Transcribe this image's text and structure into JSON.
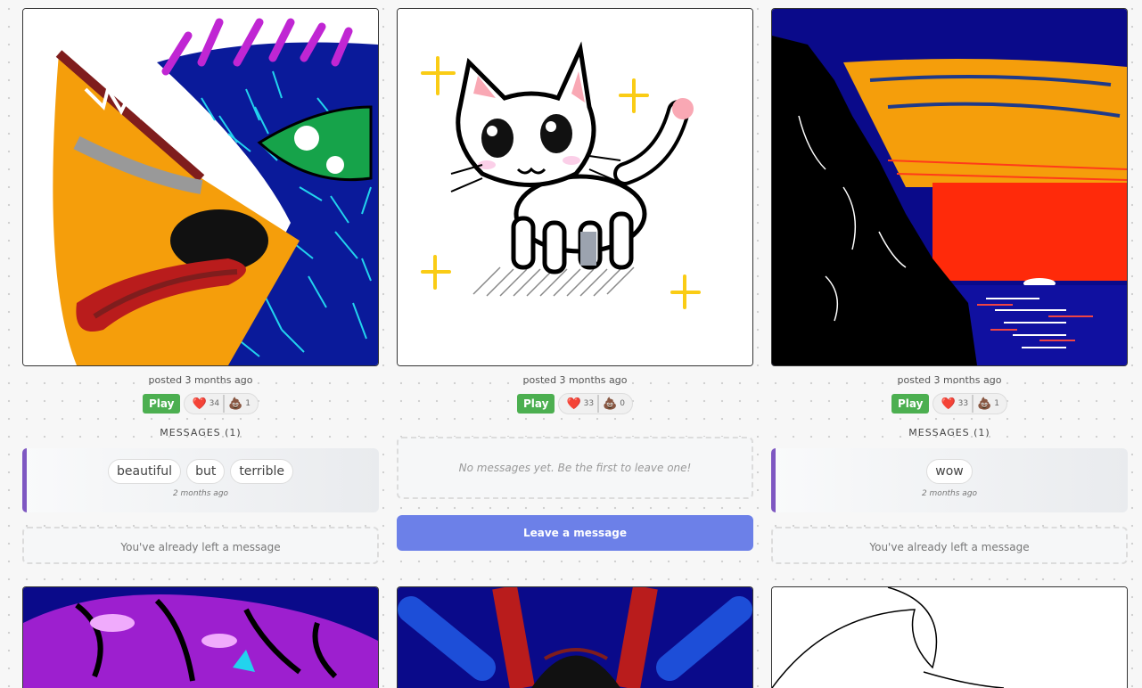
{
  "posts": [
    {
      "posted": "posted 3 months ago",
      "play_label": "Play",
      "heart_icon": "❤️",
      "likes": "34",
      "poop_icon": "💩",
      "dislikes": "1",
      "messages_title": "MESSAGES (1)",
      "message_words": [
        "beautiful",
        "but",
        "terrible"
      ],
      "message_time": "2 months ago",
      "already_text": "You've already left a message"
    },
    {
      "posted": "posted 3 months ago",
      "play_label": "Play",
      "heart_icon": "❤️",
      "likes": "33",
      "poop_icon": "💩",
      "dislikes": "0",
      "no_messages_text": "No messages yet. Be the first to leave one!",
      "leave_button": "Leave a message"
    },
    {
      "posted": "posted 3 months ago",
      "play_label": "Play",
      "heart_icon": "❤️",
      "likes": "33",
      "poop_icon": "💩",
      "dislikes": "1",
      "messages_title": "MESSAGES (1)",
      "message_words": [
        "wow"
      ],
      "message_time": "2 months ago",
      "already_text": "You've already left a message"
    }
  ],
  "colors": {
    "play": "#4caf50",
    "leave_button": "#6c80e8",
    "message_accent": "#7e57c2"
  }
}
